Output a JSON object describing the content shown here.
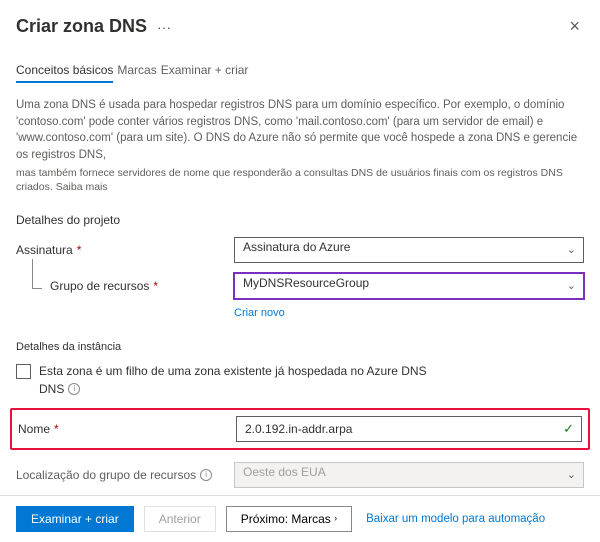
{
  "header": {
    "title": "Criar zona DNS",
    "more": "···",
    "close": "×"
  },
  "tabs": {
    "basics": "Conceitos básicos",
    "tags": "Marcas",
    "review": "Examinar + criar"
  },
  "description": {
    "p1": "Uma zona DNS é usada para hospedar registros DNS para um domínio específico. Por exemplo, o domínio 'contoso.com' pode conter vários registros DNS, como 'mail.contoso.com' (para um servidor de email) e 'www.contoso.com' (para um site). O DNS do Azure não só permite que você hospede a zona DNS e gerencie os registros DNS,",
    "p2": "mas também fornece servidores de nome que responderão a consultas DNS de usuários finais com os registros DNS criados.  ",
    "learn_more": "Saiba mais"
  },
  "project": {
    "section": "Detalhes do projeto",
    "subscription_label": "Assinatura",
    "subscription_value": "Assinatura do Azure",
    "rg_label": "Grupo de recursos",
    "rg_value": "MyDNSResourceGroup",
    "create_new": "Criar novo"
  },
  "instance": {
    "section": "Detalhes da instância",
    "child_label": "Esta zona é um filho de uma zona existente já hospedada no Azure DNS",
    "dns_short": "DNS",
    "name_label": "Nome",
    "name_value": "2.0.192.in-addr.arpa",
    "location_label": "Localização do grupo de recursos",
    "location_value": "Oeste dos EUA"
  },
  "footer": {
    "review": "Examinar + criar",
    "previous": "Anterior",
    "next": "Próximo: Marcas",
    "download": "Baixar um modelo para automação"
  },
  "glyphs": {
    "caret": "⌄",
    "check": "✓",
    "info": "i",
    "rsaquo": "›"
  }
}
